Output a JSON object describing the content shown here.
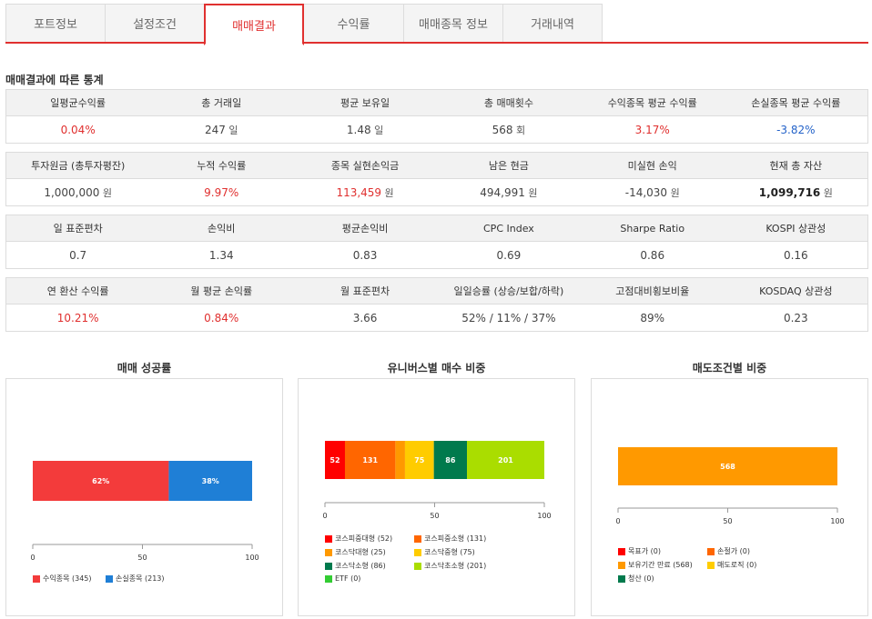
{
  "tabs": [
    {
      "label": "포트정보",
      "active": false
    },
    {
      "label": "설정조건",
      "active": false
    },
    {
      "label": "매매결과",
      "active": true
    },
    {
      "label": "수익률",
      "active": false
    },
    {
      "label": "매매종목 정보",
      "active": false
    },
    {
      "label": "거래내역",
      "active": false
    }
  ],
  "section_title": "매매결과에 따른 통계",
  "stats": [
    {
      "headers": [
        "일평균수익률",
        "총 거래일",
        "평균 보유일",
        "총 매매횟수",
        "수익종목 평균 수익률",
        "손실종목 평균 수익률"
      ],
      "values": [
        {
          "v": "0.04%",
          "u": "",
          "cls": "red"
        },
        {
          "v": "247",
          "u": "일",
          "cls": ""
        },
        {
          "v": "1.48",
          "u": "일",
          "cls": ""
        },
        {
          "v": "568",
          "u": "회",
          "cls": ""
        },
        {
          "v": "3.17%",
          "u": "",
          "cls": "red"
        },
        {
          "v": "-3.82%",
          "u": "",
          "cls": "blue"
        }
      ]
    },
    {
      "headers": [
        "투자원금 (총투자평잔)",
        "누적 수익률",
        "종목 실현손익금",
        "남은 현금",
        "미실현 손익",
        "현재 총 자산"
      ],
      "values": [
        {
          "v": "1,000,000",
          "u": "원",
          "cls": ""
        },
        {
          "v": "9.97%",
          "u": "",
          "cls": "red"
        },
        {
          "v": "113,459",
          "u": "원",
          "cls": "red"
        },
        {
          "v": "494,991",
          "u": "원",
          "cls": ""
        },
        {
          "v": "-14,030",
          "u": "원",
          "cls": ""
        },
        {
          "v": "1,099,716",
          "u": "원",
          "cls": "bold"
        }
      ]
    },
    {
      "headers": [
        "일 표준편차",
        "손익비",
        "평균손익비",
        "CPC Index",
        "Sharpe Ratio",
        "KOSPI 상관성"
      ],
      "values": [
        {
          "v": "0.7",
          "u": "",
          "cls": ""
        },
        {
          "v": "1.34",
          "u": "",
          "cls": ""
        },
        {
          "v": "0.83",
          "u": "",
          "cls": ""
        },
        {
          "v": "0.69",
          "u": "",
          "cls": ""
        },
        {
          "v": "0.86",
          "u": "",
          "cls": ""
        },
        {
          "v": "0.16",
          "u": "",
          "cls": ""
        }
      ]
    },
    {
      "headers": [
        "연 환산 수익률",
        "월 평균 손익률",
        "월 표준편차",
        "일일승률 (상승/보합/하락)",
        "고점대비횡보비율",
        "KOSDAQ 상관성"
      ],
      "values": [
        {
          "v": "10.21%",
          "u": "",
          "cls": "red"
        },
        {
          "v": "0.84%",
          "u": "",
          "cls": "red"
        },
        {
          "v": "3.66",
          "u": "",
          "cls": ""
        },
        {
          "v": "52% / 11% / 37%",
          "u": "",
          "cls": ""
        },
        {
          "v": "89%",
          "u": "",
          "cls": ""
        },
        {
          "v": "0.23",
          "u": "",
          "cls": ""
        }
      ]
    }
  ],
  "chart_data": [
    {
      "type": "bar",
      "orientation": "horizontal-stacked-percent",
      "title": "매매 성공률",
      "xlim": [
        0,
        100
      ],
      "ticks": [
        "0",
        "50",
        "100"
      ],
      "series": [
        {
          "name": "수익종목 (345)",
          "value": 62,
          "label": "62%",
          "color": "#f33b3b"
        },
        {
          "name": "손실종목 (213)",
          "value": 38,
          "label": "38%",
          "color": "#1f7fd6"
        }
      ]
    },
    {
      "type": "bar",
      "orientation": "horizontal-stacked-percent",
      "title": "유니버스별 매수 비중",
      "xlim": [
        0,
        100
      ],
      "ticks": [
        "0",
        "50",
        "100"
      ],
      "series": [
        {
          "name": "코스피중대형 (52)",
          "value": 52,
          "label": "52",
          "color": "#ff0000"
        },
        {
          "name": "코스피중소형 (131)",
          "value": 131,
          "label": "131",
          "color": "#ff6600"
        },
        {
          "name": "코스닥대형 (25)",
          "value": 25,
          "label": "",
          "color": "#ff9900"
        },
        {
          "name": "코스닥중형 (75)",
          "value": 75,
          "label": "75",
          "color": "#ffcc00"
        },
        {
          "name": "코스닥소형 (86)",
          "value": 86,
          "label": "86",
          "color": "#007a4d"
        },
        {
          "name": "코스닥초소형 (201)",
          "value": 201,
          "label": "201",
          "color": "#aadd00"
        },
        {
          "name": "ETF (0)",
          "value": 0,
          "label": "",
          "color": "#33cc33"
        }
      ]
    },
    {
      "type": "bar",
      "orientation": "horizontal-stacked-percent",
      "title": "매도조건별 비중",
      "xlim": [
        0,
        100
      ],
      "ticks": [
        "0",
        "50",
        "100"
      ],
      "series": [
        {
          "name": "목표가 (0)",
          "value": 0,
          "label": "",
          "color": "#ff0000"
        },
        {
          "name": "손절가 (0)",
          "value": 0,
          "label": "",
          "color": "#ff6600"
        },
        {
          "name": "보유기간 만료 (568)",
          "value": 568,
          "label": "568",
          "color": "#ff9900"
        },
        {
          "name": "매도로직 (0)",
          "value": 0,
          "label": "",
          "color": "#ffcc00"
        },
        {
          "name": "청산 (0)",
          "value": 0,
          "label": "",
          "color": "#007a4d"
        }
      ]
    }
  ]
}
